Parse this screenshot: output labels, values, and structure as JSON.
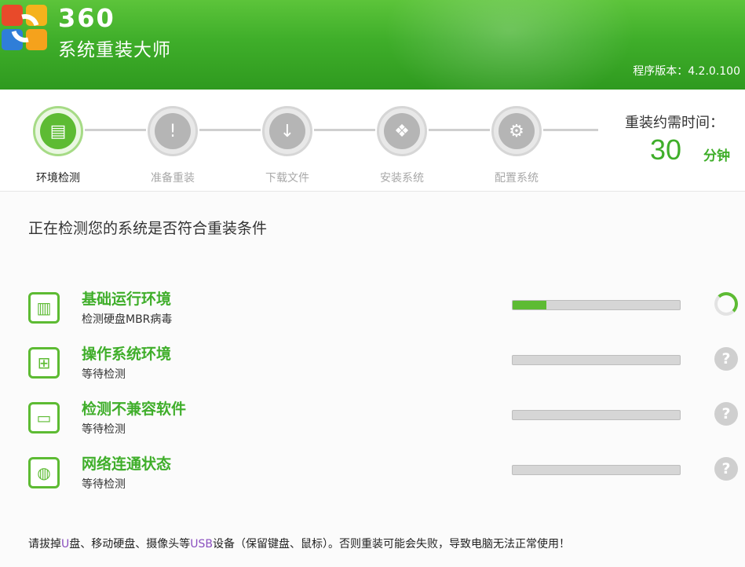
{
  "header": {
    "app_name_line1": "360",
    "app_name_line2": "系统重装大师",
    "version": "程序版本：4.2.0.100"
  },
  "steps": [
    {
      "label": "环境检测",
      "icon": "computer-icon",
      "active": true
    },
    {
      "label": "准备重装",
      "icon": "clipboard-icon",
      "active": false
    },
    {
      "label": "下载文件",
      "icon": "download-icon",
      "active": false
    },
    {
      "label": "安装系统",
      "icon": "install-box-icon",
      "active": false
    },
    {
      "label": "配置系统",
      "icon": "windows-gear-icon",
      "active": false
    }
  ],
  "time": {
    "title": "重装约需时间：",
    "value": "30",
    "unit": "分钟"
  },
  "main": {
    "title": "正在检测您的系统是否符合重装条件"
  },
  "checks": [
    {
      "title": "基础运行环境",
      "subtitle": "检测硬盘MBR病毒",
      "icon": "computer-tower-icon",
      "progress": 0.2,
      "status": "running"
    },
    {
      "title": "操作系统环境",
      "subtitle": "等待检测",
      "icon": "windows-logo-icon",
      "progress": 0.0,
      "status": "waiting"
    },
    {
      "title": "检测不兼容软件",
      "subtitle": "等待检测",
      "icon": "monitor-icon",
      "progress": 0.0,
      "status": "waiting"
    },
    {
      "title": "网络连通状态",
      "subtitle": "等待检测",
      "icon": "globe-icon",
      "progress": 0.0,
      "status": "waiting"
    }
  ],
  "status_waiting_glyph": "?",
  "footer": {
    "p1": "请拔掉",
    "h1": "U",
    "p2": "盘、移动硬盘、摄像头等",
    "h2": "USB",
    "p3": "设备（保留键盘、鼠标）。否则重装可能会失败，导致电脑无法正常使用！"
  },
  "colors": {
    "accent_green": "#3fae2a",
    "inactive_gray": "#b5b5b5"
  }
}
